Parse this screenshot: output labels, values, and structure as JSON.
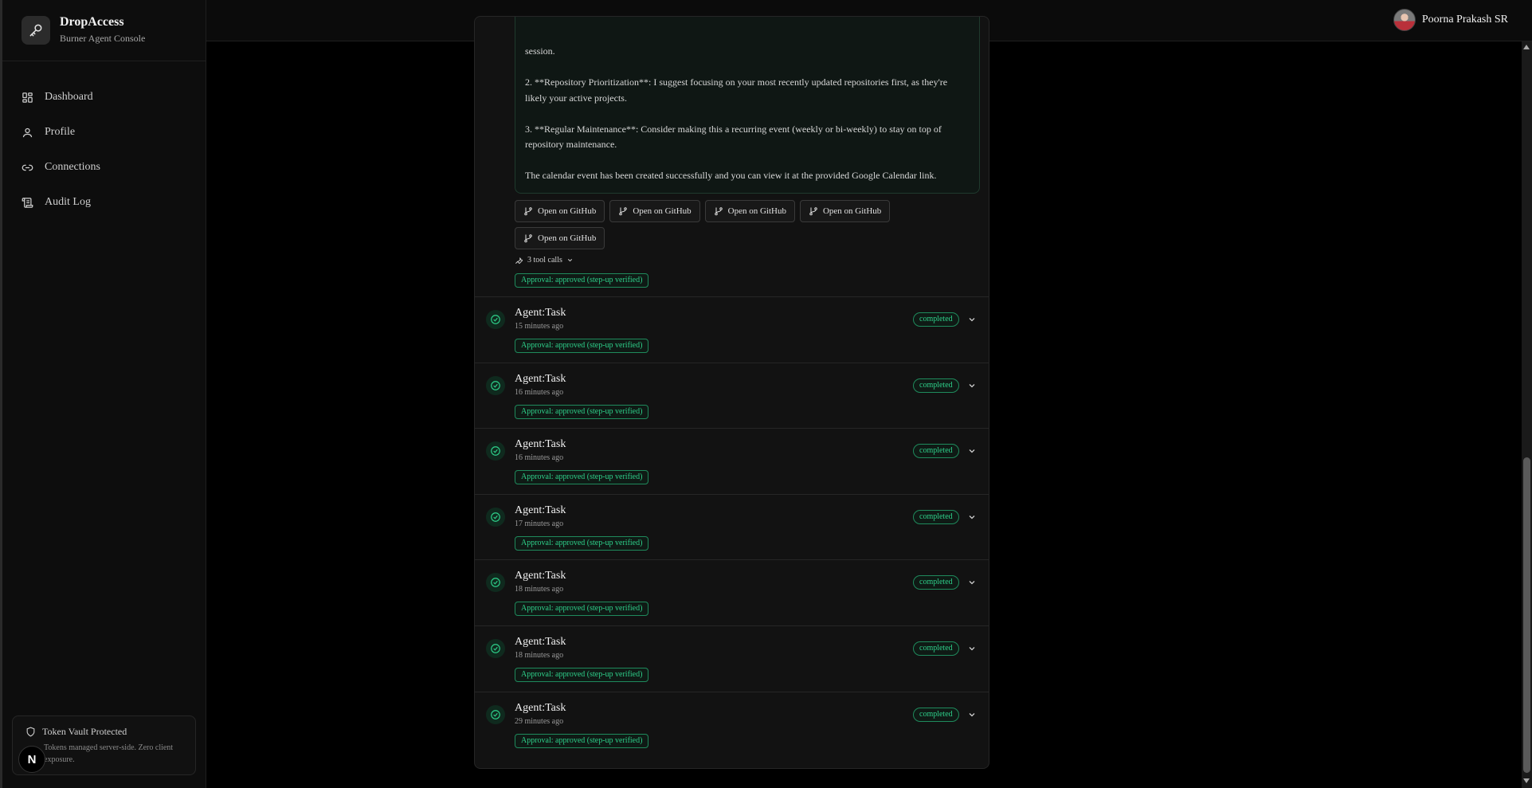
{
  "brand": {
    "title": "DropAccess",
    "subtitle": "Burner Agent Console",
    "logo_icon": "key-icon"
  },
  "nav": [
    {
      "label": "Dashboard",
      "icon": "grid-icon"
    },
    {
      "label": "Profile",
      "icon": "user-icon"
    },
    {
      "label": "Connections",
      "icon": "link-icon"
    },
    {
      "label": "Audit Log",
      "icon": "scroll-icon"
    }
  ],
  "vault": {
    "title": "Token Vault Protected",
    "description": "Tokens managed server-side. Zero client exposure."
  },
  "next_badge": "N",
  "user": {
    "name": "Poorna Prakash SR"
  },
  "response": {
    "paragraphs": [
      "session.",
      "2. **Repository Prioritization**: I suggest focusing on your most recently updated repositories first, as they're likely your active projects.",
      "3. **Regular Maintenance**: Consider making this a recurring event (weekly or bi-weekly) to stay on top of repository maintenance.",
      "The calendar event has been created successfully and you can view it at the provided Google Calendar link."
    ]
  },
  "github_buttons": [
    "Open on GitHub",
    "Open on GitHub",
    "Open on GitHub",
    "Open on GitHub",
    "Open on GitHub"
  ],
  "tool_calls": "3 tool calls",
  "first_approval": "Approval: approved (step-up verified)",
  "tasks": [
    {
      "title": "Agent:Task",
      "time": "15 minutes ago",
      "status": "completed",
      "approval": "Approval: approved (step-up verified)"
    },
    {
      "title": "Agent:Task",
      "time": "16 minutes ago",
      "status": "completed",
      "approval": "Approval: approved (step-up verified)"
    },
    {
      "title": "Agent:Task",
      "time": "16 minutes ago",
      "status": "completed",
      "approval": "Approval: approved (step-up verified)"
    },
    {
      "title": "Agent:Task",
      "time": "17 minutes ago",
      "status": "completed",
      "approval": "Approval: approved (step-up verified)"
    },
    {
      "title": "Agent:Task",
      "time": "18 minutes ago",
      "status": "completed",
      "approval": "Approval: approved (step-up verified)"
    },
    {
      "title": "Agent:Task",
      "time": "18 minutes ago",
      "status": "completed",
      "approval": "Approval: approved (step-up verified)"
    },
    {
      "title": "Agent:Task",
      "time": "29 minutes ago",
      "status": "completed",
      "approval": "Approval: approved (step-up verified)"
    }
  ],
  "colors": {
    "accent": "#2ed08a",
    "background": "#000000",
    "panel": "#121212"
  }
}
